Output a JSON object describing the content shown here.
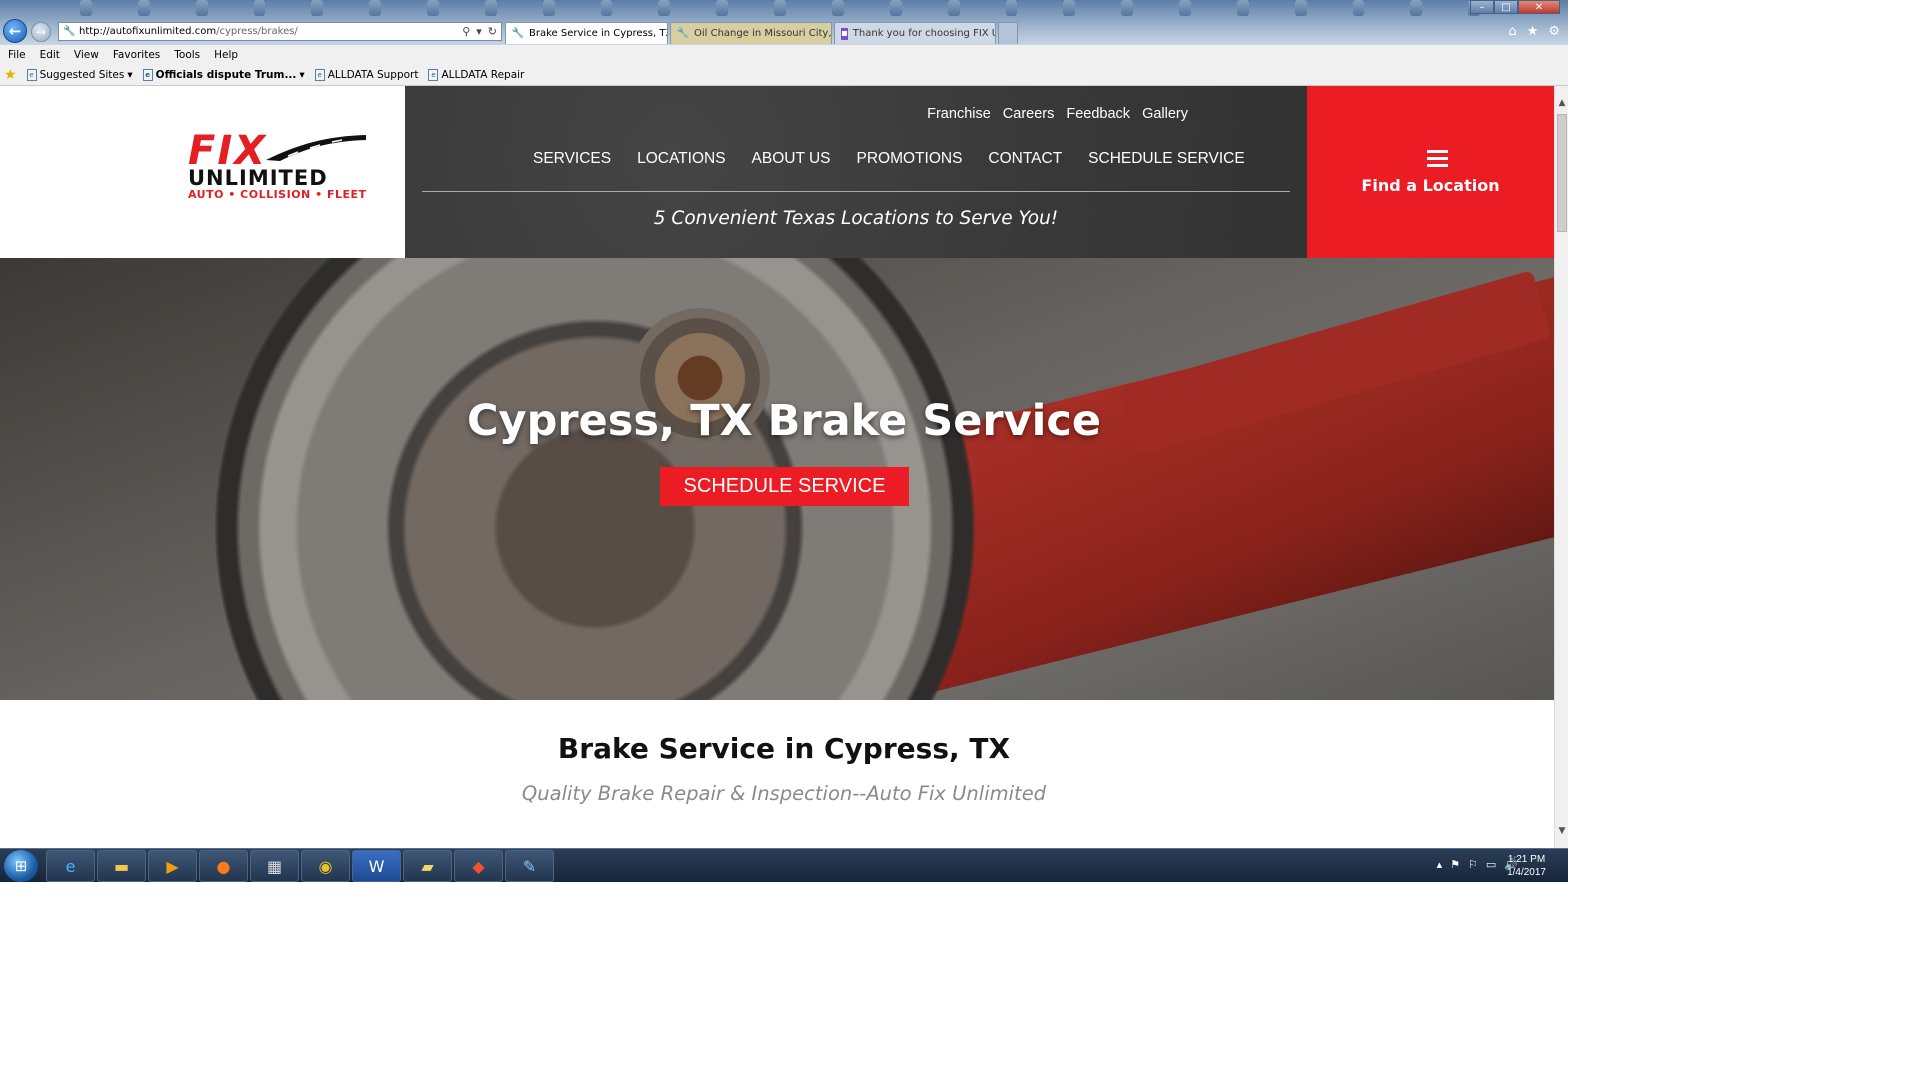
{
  "browser": {
    "url_host": "http://autofixunlimited.com",
    "url_path": "/cypress/brakes/",
    "tabs": [
      {
        "label": "Brake Service in Cypress, TX...",
        "active": true
      },
      {
        "label": "Oil Change in Missouri City, T...",
        "active": false
      },
      {
        "label": "Thank you for choosing FIX Un...",
        "active": false
      }
    ],
    "menu": [
      "File",
      "Edit",
      "View",
      "Favorites",
      "Tools",
      "Help"
    ],
    "favorites": [
      {
        "label": "Suggested Sites",
        "bold": false
      },
      {
        "label": "Officials dispute Trum...",
        "bold": true
      },
      {
        "label": "ALLDATA Support",
        "bold": false
      },
      {
        "label": "ALLDATA Repair",
        "bold": false
      }
    ]
  },
  "site": {
    "logo": {
      "line1": "FIX",
      "line2": "UNLIMITED",
      "line3": "AUTO • COLLISION • FLEET"
    },
    "util_links": [
      "Franchise",
      "Careers",
      "Feedback",
      "Gallery"
    ],
    "main_nav": [
      "SERVICES",
      "LOCATIONS",
      "ABOUT US",
      "PROMOTIONS",
      "CONTACT",
      "SCHEDULE SERVICE"
    ],
    "tagline": "5 Convenient Texas Locations to Serve You!",
    "find_location": "Find a Location",
    "hero_title": "Cypress, TX Brake Service",
    "hero_cta": "SCHEDULE SERVICE",
    "section_title": "Brake Service in Cypress, TX",
    "section_subtitle": "Quality Brake Repair & Inspection--Auto Fix Unlimited"
  },
  "taskbar": {
    "time": "1:21 PM",
    "date": "1/4/2017"
  },
  "colors": {
    "brand_red": "#ec1c24",
    "nav_dark": "#3c3c3c"
  }
}
